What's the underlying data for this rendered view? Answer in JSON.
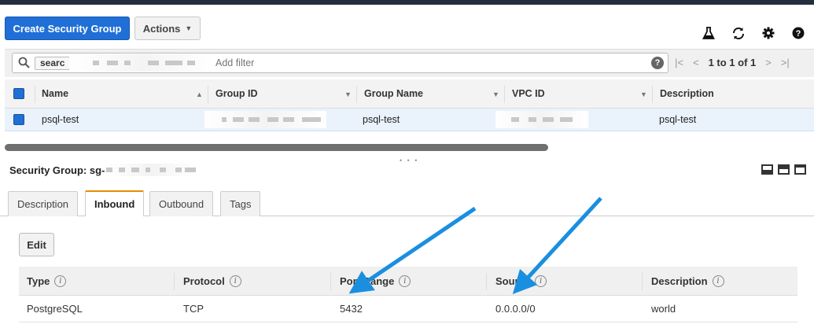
{
  "toolbar": {
    "create_label": "Create Security Group",
    "actions_label": "Actions",
    "icons": [
      "flask-icon",
      "refresh-icon",
      "gear-icon",
      "help-icon"
    ]
  },
  "filter": {
    "token_label": "searc",
    "placeholder": "Add filter",
    "pagination_text": "1 to 1 of 1"
  },
  "grid": {
    "columns": [
      "Name",
      "Group ID",
      "Group Name",
      "VPC ID",
      "Description"
    ],
    "rows": [
      {
        "name": "psql-test",
        "group_name": "psql-test",
        "description": "psql-test"
      }
    ]
  },
  "details": {
    "title_prefix": "Security Group: sg-",
    "tabs": [
      "Description",
      "Inbound",
      "Outbound",
      "Tags"
    ],
    "active_tab": "Inbound",
    "edit_label": "Edit",
    "rule_columns": [
      "Type",
      "Protocol",
      "Port Range",
      "Source",
      "Description"
    ],
    "rules": [
      {
        "type": "PostgreSQL",
        "protocol": "TCP",
        "port_range": "5432",
        "source": "0.0.0.0/0",
        "description": "world"
      }
    ]
  },
  "colors": {
    "primary": "#1f6fd6",
    "active_tab_accent": "#e88b00",
    "selected_row": "#eaf3fb",
    "annotation_arrow": "#1a8fe0"
  }
}
